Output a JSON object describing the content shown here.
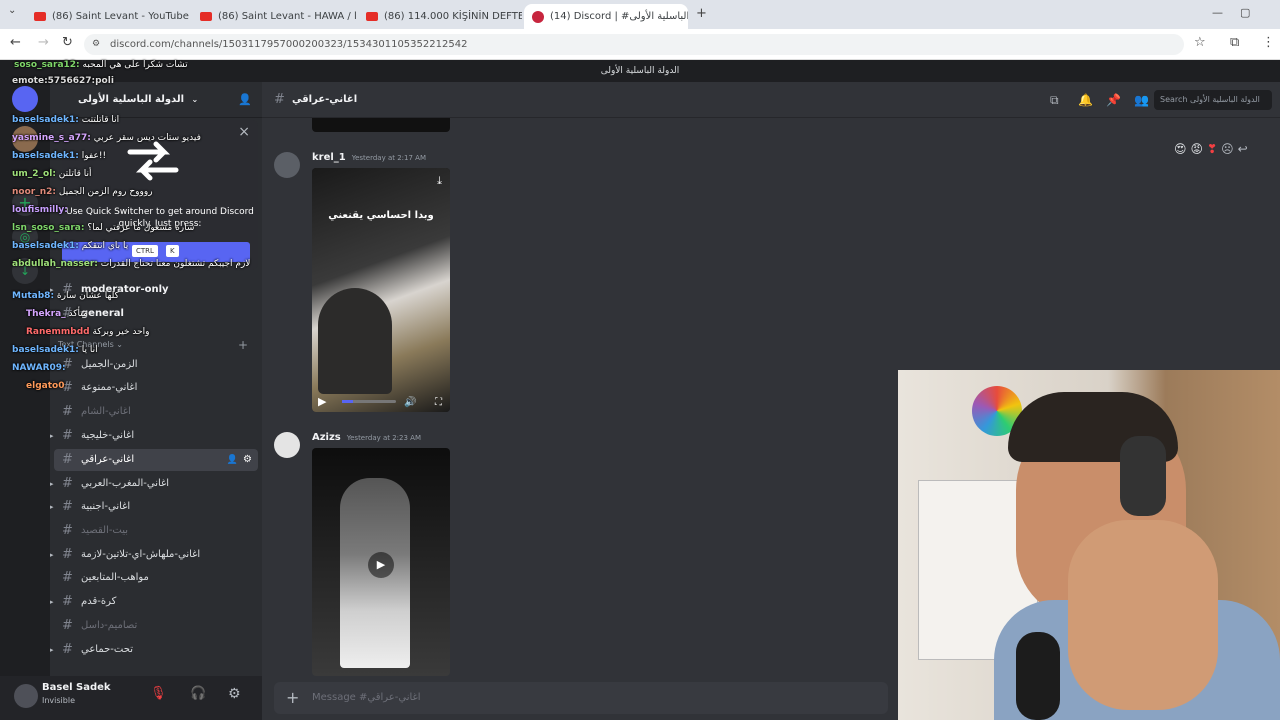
{
  "browser": {
    "tabs": [
      {
        "label": "(86) Saint Levant - YouTube",
        "kind": "youtube"
      },
      {
        "label": "(86) Saint Levant - HAWA / هوا",
        "kind": "youtube"
      },
      {
        "label": "(86) 114.000 KİŞİNİN DEFTERİN",
        "kind": "youtube"
      },
      {
        "label": "(14) Discord | #الباسلية الأولى",
        "kind": "discord"
      }
    ],
    "new_tab": "+",
    "url": "discord.com/channels/1503117957000200323/1534301105352212542"
  },
  "discord": {
    "window_title": "الدولة الباسلية الأولى",
    "server_name": "الدولة الباسلية الأولى",
    "channel_name": "اغاني-عراقي",
    "search_placeholder": "Search الدولة الباسلية الأولى",
    "category_label": "Text Channels",
    "channels": [
      {
        "name": "moderator-only",
        "muted": false,
        "bold": true,
        "arrow": true
      },
      {
        "name": "general",
        "muted": false,
        "bold": true,
        "arrow": false
      },
      {
        "name": "الزمن-الجميل",
        "muted": false,
        "bold": false,
        "arrow": false
      },
      {
        "name": "اغاني-ممنوعة",
        "muted": false,
        "bold": false,
        "arrow": false
      },
      {
        "name": "اغاني-الشام",
        "muted": true,
        "bold": false,
        "arrow": false
      },
      {
        "name": "اغاني-خليجية",
        "muted": false,
        "bold": false,
        "arrow": true
      },
      {
        "name": "اغاني-عراقي",
        "muted": false,
        "bold": false,
        "arrow": false,
        "selected": true
      },
      {
        "name": "اغاني-المغرب-العربي",
        "muted": false,
        "bold": false,
        "arrow": true
      },
      {
        "name": "اغاني-اجنبية",
        "muted": false,
        "bold": false,
        "arrow": true
      },
      {
        "name": "بيت-القصيد",
        "muted": true,
        "bold": false,
        "arrow": false
      },
      {
        "name": "اغاني-ملهاش-اي-تلاتين-لازمة",
        "muted": false,
        "bold": false,
        "arrow": true
      },
      {
        "name": "مواهب-المتابعين",
        "muted": false,
        "bold": false,
        "arrow": false
      },
      {
        "name": "كرة-قدم",
        "muted": false,
        "bold": false,
        "arrow": true
      },
      {
        "name": "تصاميم-داسل",
        "muted": true,
        "bold": false,
        "arrow": false
      },
      {
        "name": "تحت-حماعي",
        "muted": false,
        "bold": false,
        "arrow": true
      }
    ],
    "quick_switcher": {
      "text": "Use Quick Switcher to get around Discord quickly. Just press:",
      "key1": "CTRL",
      "key2": "K",
      "close": "×"
    },
    "messages": [
      {
        "author": "krel_1",
        "time": "Yesterday at 2:17 AM",
        "media_caption": "وبدا احساسي يقنعني"
      },
      {
        "author": "Azizs",
        "time": "Yesterday at 2:23 AM",
        "media_caption": ""
      }
    ],
    "composer_placeholder": "Message #اغاني-عراقي",
    "user": {
      "name": "Basel Sadek",
      "status": "Invisible"
    },
    "reactions": [
      "😍",
      "😡",
      "❣",
      "☹",
      "↩"
    ]
  },
  "overlay_chat": [
    {
      "name": "soso_sara12:",
      "text": "تشات شكرا على هي المحبه",
      "color": "#7fd66a"
    },
    {
      "name": "emote:5756627:poli",
      "text": "",
      "color": "#dddddd"
    },
    {
      "name": "baselsadek1:",
      "text": "انا قاتلتتت",
      "color": "#6fb6ff"
    },
    {
      "name": "yasmine_s_a77:",
      "text": "فيديو ستات ديس سقر عربي",
      "color": "#d6a6ff"
    },
    {
      "name": "baselsadek1:",
      "text": "عفوا!!",
      "color": "#6fb6ff"
    },
    {
      "name": "um_2_ol:",
      "text": "أنا قاتلتن",
      "color": "#9fe07a"
    },
    {
      "name": "noor_n2:",
      "text": "روووح روم الزمن الجميل",
      "color": "#e08a7a"
    },
    {
      "name": "loufismilly:",
      "text": "",
      "color": "#c9a0ff"
    },
    {
      "name": "lsn_soso_sara:",
      "text": "سارة مشغول ما عرفتي لما؟",
      "color": "#7fd66a"
    },
    {
      "name": "baselsadek1:",
      "text": "يا باي انتقكم",
      "color": "#6fb6ff"
    },
    {
      "name": "abdullah_nasser:",
      "text": "لازم اجيبكم تشتغلون معنا تحتاج القدرات",
      "color": "#9fe07a"
    },
    {
      "name": "Mutab8:",
      "text": "كلها عشان سارة",
      "color": "#6fb6ff"
    },
    {
      "name": "Thekra_",
      "text": "متأكد",
      "color": "#d6a6ff"
    },
    {
      "name": "Ranemmbdd",
      "text": "واحد خير وبركة",
      "color": "#ff6b6b"
    },
    {
      "name": "baselsadek1:",
      "text": "انا يا",
      "color": "#6fb6ff"
    },
    {
      "name": "NAWAR09:",
      "text": "",
      "color": "#6fb6ff"
    },
    {
      "name": "elgato0",
      "text": "",
      "color": "#ff9a5a"
    }
  ]
}
